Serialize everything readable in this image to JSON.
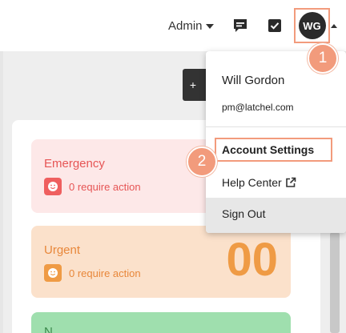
{
  "header": {
    "role_menu_label": "Admin",
    "user_initials": "WG"
  },
  "add_button_label": "+",
  "summary": {
    "emergency": {
      "title": "Emergency",
      "status": "0 require action"
    },
    "urgent": {
      "title": "Urgent",
      "status": "0 require action",
      "count": "00"
    },
    "normal": {
      "title": "N"
    }
  },
  "user_menu": {
    "name": "Will Gordon",
    "email": "pm@latchel.com",
    "items": [
      {
        "label": "Account Settings"
      },
      {
        "label": "Help Center"
      },
      {
        "label": "Sign Out"
      }
    ]
  },
  "steps": [
    "1",
    "2"
  ],
  "colors": {
    "highlight": "#f29b7c",
    "emergency": "#e65555",
    "urgent": "#ef9b45",
    "normal": "#9fdfae"
  }
}
